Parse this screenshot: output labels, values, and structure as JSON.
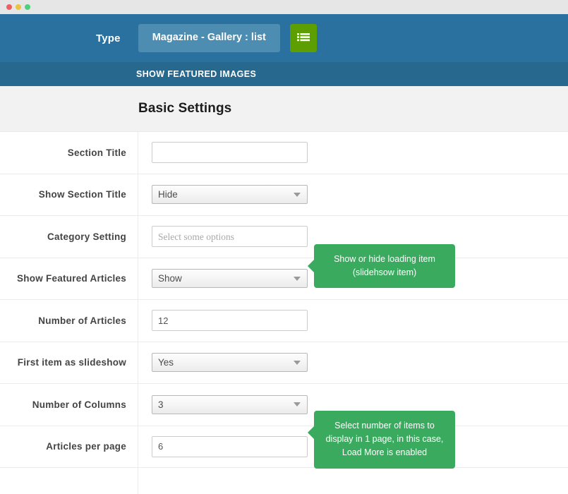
{
  "window": {
    "traffic_lights": [
      "close",
      "minimize",
      "maximize"
    ]
  },
  "header": {
    "type_label": "Type",
    "type_value": "Magazine - Gallery : list",
    "menu_button_icon": "list-icon",
    "subheader_title": "SHOW FEATURED IMAGES",
    "colors": {
      "bar_blue": "#2a719f",
      "subbar_blue": "#27688f",
      "select_blue": "#4c8db1",
      "menu_green": "#5d9e02",
      "tooltip_green": "#3aaa5e"
    }
  },
  "section": {
    "title": "Basic Settings"
  },
  "form": {
    "rows": [
      {
        "label": "Section Title",
        "field_type": "text",
        "value": "",
        "placeholder": ""
      },
      {
        "label": "Show Section Title",
        "field_type": "select",
        "value": "Hide"
      },
      {
        "label": "Category Setting",
        "field_type": "text",
        "value": "",
        "placeholder": "Select some options"
      },
      {
        "label": "Show Featured Articles",
        "field_type": "select",
        "value": "Show",
        "tooltip": "Show or hide loading item (slidehsow item)"
      },
      {
        "label": "Number of Articles",
        "field_type": "text",
        "value": "12",
        "placeholder": ""
      },
      {
        "label": "First item as slideshow",
        "field_type": "select",
        "value": "Yes"
      },
      {
        "label": "Number of Columns",
        "field_type": "select",
        "value": "3"
      },
      {
        "label": "Articles per page",
        "field_type": "text",
        "value": "6",
        "placeholder": "",
        "tooltip": "Select number of items to display in 1 page, in this case, Load More is enabled"
      }
    ]
  },
  "tooltips": {
    "featured": {
      "line1": "Show or hide loading item",
      "line2": "(slidehsow item)"
    },
    "per_page": {
      "line1": "Select number of items to",
      "line2": "display in 1 page, in this case,",
      "line3": "Load More is enabled"
    }
  }
}
